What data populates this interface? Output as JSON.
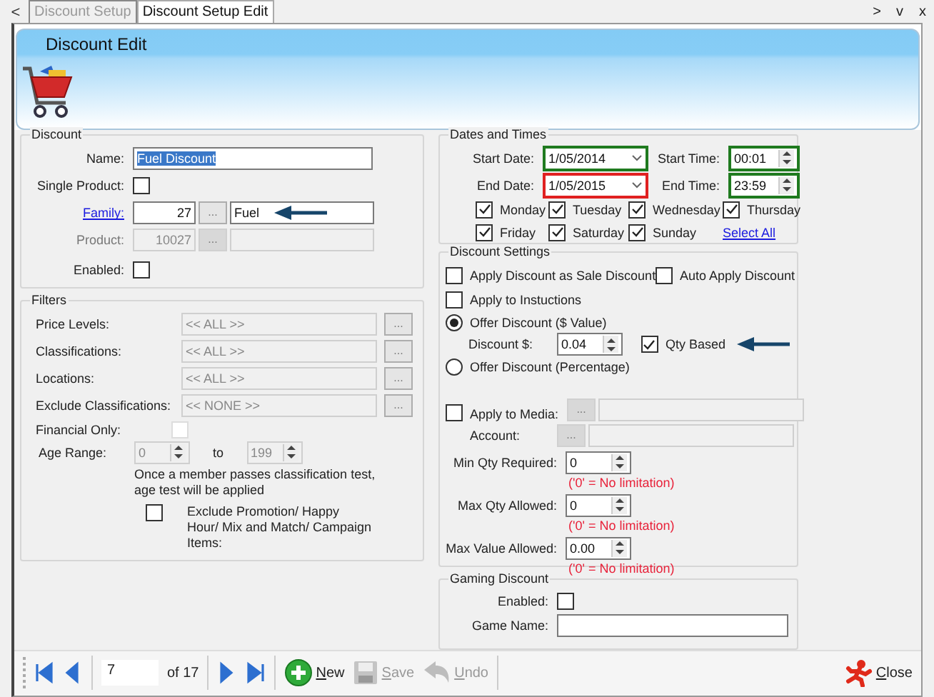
{
  "tabs": {
    "back": "<",
    "items": [
      {
        "label": "Discount Setup",
        "selected": false
      },
      {
        "label": "Discount Setup Edit",
        "selected": true
      }
    ],
    "controls": [
      ">",
      "v",
      "x"
    ]
  },
  "header": {
    "title": "Discount Edit"
  },
  "discount": {
    "title": "Discount",
    "name": {
      "label": "Name:",
      "value": "Fuel Discount"
    },
    "single_product": {
      "label": "Single Product:",
      "checked": false
    },
    "family": {
      "label": "Family:",
      "link": true,
      "code": "27",
      "button": "...",
      "value": "Fuel",
      "disabled": false,
      "arrow": true
    },
    "product": {
      "label": "Product:",
      "link": false,
      "code": "10027",
      "button": "...",
      "disabled": true,
      "arrow": false
    },
    "enabled": {
      "label": "Enabled:",
      "checked": false
    }
  },
  "filters": {
    "title": "Filters",
    "rows": [
      {
        "label": "Price Levels:",
        "value": "<< ALL >>",
        "button": "..."
      },
      {
        "label": "Classifications:",
        "value": "<< ALL >>",
        "button": "..."
      },
      {
        "label": "Locations:",
        "value": "<< ALL >>",
        "button": "..."
      },
      {
        "label": "Exclude Classifications:",
        "value": "<< NONE >>",
        "button": "..."
      }
    ],
    "financial_only": {
      "label": "Financial Only:",
      "checked": false
    },
    "age_range": {
      "label": "Age Range:",
      "from": "0",
      "separator": "to",
      "to": "199",
      "disabled": true
    },
    "note": "Once a member passes classification test, age test will be applied",
    "exclude": {
      "label": "Exclude Promotion/ Happy Hour/ Mix and Match/ Campaign Items:",
      "checked": false
    }
  },
  "dates": {
    "title": "Dates and Times",
    "fields": [
      {
        "kind": "date",
        "label": "Start Date:",
        "value": "1/05/2014",
        "color": "#1f7a1f"
      },
      {
        "kind": "time",
        "label": "Start Time:",
        "value": "00:01",
        "color": "#1f7a1f"
      },
      {
        "kind": "date",
        "label": "End Date:",
        "value": "1/05/2015",
        "color": "#e02020"
      },
      {
        "kind": "time",
        "label": "End Time:",
        "value": "23:59",
        "color": "#1f7a1f"
      }
    ],
    "days": [
      {
        "label": "Monday",
        "checked": true
      },
      {
        "label": "Tuesday",
        "checked": true
      },
      {
        "label": "Wednesday",
        "checked": true
      },
      {
        "label": "Thursday",
        "checked": true
      },
      {
        "label": "Friday",
        "checked": true
      },
      {
        "label": "Saturday",
        "checked": true
      },
      {
        "label": "Sunday",
        "checked": true
      }
    ],
    "select_all": "Select All"
  },
  "settings": {
    "title": "Discount Settings",
    "sale_discount": {
      "label": "Apply Discount as Sale Discount",
      "checked": false
    },
    "auto_apply": {
      "label": "Auto Apply Discount",
      "checked": false
    },
    "instructions": {
      "label": "Apply to Instuctions",
      "checked": false
    },
    "offer_value": {
      "label": "Offer Discount ($ Value)",
      "selected": true
    },
    "discount_amount": {
      "label": "Discount $:",
      "value": "0.04"
    },
    "qty_based": {
      "label": "Qty Based",
      "checked": true,
      "arrow": true
    },
    "offer_percentage": {
      "label": "Offer Discount (Percentage)",
      "selected": false
    },
    "media": {
      "label": "Apply to Media:",
      "checked": false,
      "button": "..."
    },
    "account": {
      "label": "Account:",
      "button": "..."
    },
    "limits": [
      {
        "label": "Min Qty Required:",
        "value": "0",
        "note": "('0' = No limitation)"
      },
      {
        "label": "Max Qty Allowed:",
        "value": "0",
        "note": "('0' = No limitation)"
      },
      {
        "label": "Max Value Allowed:",
        "value": "0.00",
        "note": "('0' = No limitation)"
      }
    ]
  },
  "gaming": {
    "title": "Gaming Discount",
    "enabled": {
      "label": "Enabled:",
      "checked": false
    },
    "game_name": {
      "label": "Game Name:"
    }
  },
  "toolbar": {
    "page": "7",
    "of": "of 17",
    "actions": [
      {
        "kind": "new",
        "label": "New",
        "disabled": false
      },
      {
        "kind": "save",
        "label": "Save",
        "disabled": true
      },
      {
        "kind": "undo",
        "label": "Undo",
        "disabled": true
      }
    ],
    "close": "Close"
  }
}
